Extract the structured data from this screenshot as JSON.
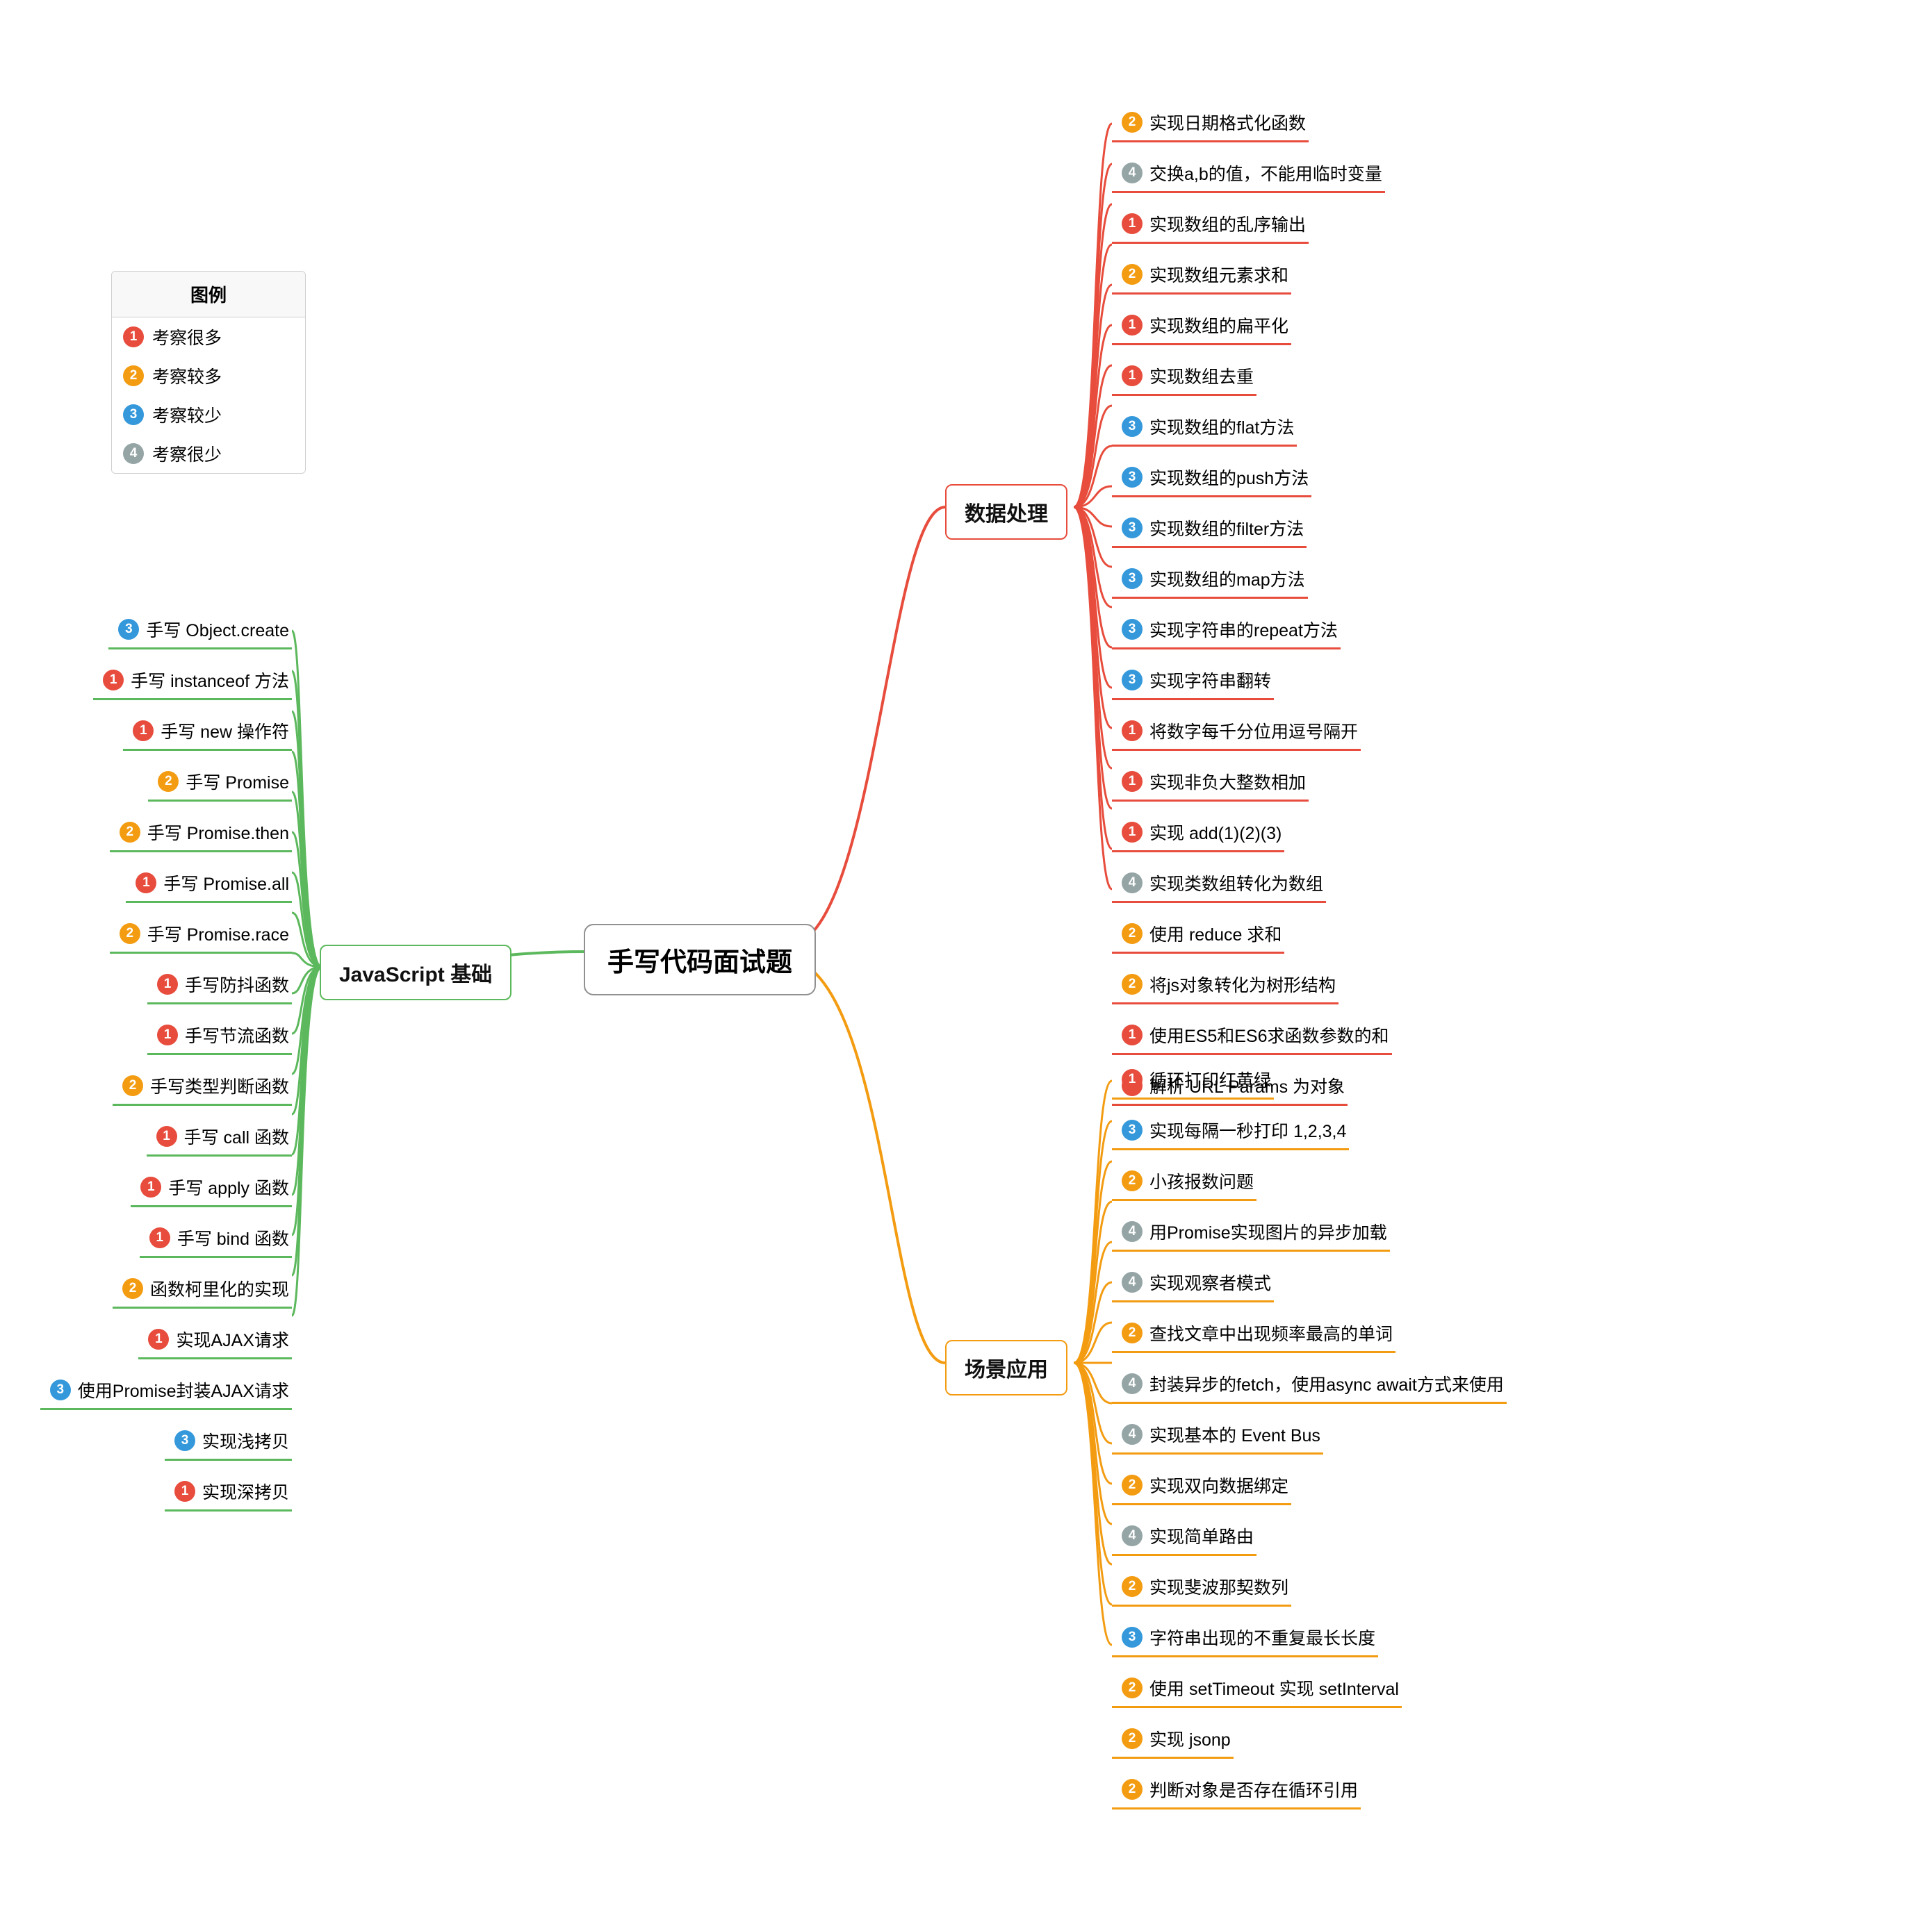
{
  "root": "手写代码面试题",
  "legend": {
    "title": "图例",
    "items": [
      {
        "level": 1,
        "text": "考察很多"
      },
      {
        "level": 2,
        "text": "考察较多"
      },
      {
        "level": 3,
        "text": "考察较少"
      },
      {
        "level": 4,
        "text": "考察很少"
      }
    ]
  },
  "branches": {
    "js": {
      "label": "JavaScript 基础",
      "color": "green",
      "side": "left",
      "items": [
        {
          "level": 3,
          "text": "手写 Object.create"
        },
        {
          "level": 1,
          "text": "手写 instanceof 方法"
        },
        {
          "level": 1,
          "text": "手写 new 操作符"
        },
        {
          "level": 2,
          "text": "手写 Promise"
        },
        {
          "level": 2,
          "text": "手写 Promise.then"
        },
        {
          "level": 1,
          "text": "手写 Promise.all"
        },
        {
          "level": 2,
          "text": "手写 Promise.race"
        },
        {
          "level": 1,
          "text": "手写防抖函数"
        },
        {
          "level": 1,
          "text": "手写节流函数"
        },
        {
          "level": 2,
          "text": "手写类型判断函数"
        },
        {
          "level": 1,
          "text": "手写 call 函数"
        },
        {
          "level": 1,
          "text": "手写 apply 函数"
        },
        {
          "level": 1,
          "text": "手写 bind 函数"
        },
        {
          "level": 2,
          "text": "函数柯里化的实现"
        },
        {
          "level": 1,
          "text": "实现AJAX请求"
        },
        {
          "level": 3,
          "text": "使用Promise封装AJAX请求"
        },
        {
          "level": 3,
          "text": "实现浅拷贝"
        },
        {
          "level": 1,
          "text": "实现深拷贝"
        }
      ]
    },
    "data": {
      "label": "数据处理",
      "color": "red",
      "side": "right",
      "items": [
        {
          "level": 2,
          "text": "实现日期格式化函数"
        },
        {
          "level": 4,
          "text": "交换a,b的值，不能用临时变量"
        },
        {
          "level": 1,
          "text": "实现数组的乱序输出"
        },
        {
          "level": 2,
          "text": "实现数组元素求和"
        },
        {
          "level": 1,
          "text": "实现数组的扁平化"
        },
        {
          "level": 1,
          "text": "实现数组去重"
        },
        {
          "level": 3,
          "text": "实现数组的flat方法"
        },
        {
          "level": 3,
          "text": "实现数组的push方法"
        },
        {
          "level": 3,
          "text": "实现数组的filter方法"
        },
        {
          "level": 3,
          "text": "实现数组的map方法"
        },
        {
          "level": 3,
          "text": "实现字符串的repeat方法"
        },
        {
          "level": 3,
          "text": "实现字符串翻转"
        },
        {
          "level": 1,
          "text": "将数字每千分位用逗号隔开"
        },
        {
          "level": 1,
          "text": "实现非负大整数相加"
        },
        {
          "level": 1,
          "text": "实现 add(1)(2)(3)"
        },
        {
          "level": 4,
          "text": "实现类数组转化为数组"
        },
        {
          "level": 2,
          "text": "使用 reduce 求和"
        },
        {
          "level": 2,
          "text": "将js对象转化为树形结构"
        },
        {
          "level": 1,
          "text": "使用ES5和ES6求函数参数的和"
        },
        {
          "level": 1,
          "text": "解析 URL Params 为对象"
        }
      ]
    },
    "scene": {
      "label": "场景应用",
      "color": "orange",
      "side": "right",
      "items": [
        {
          "level": 1,
          "text": "循环打印红黄绿"
        },
        {
          "level": 3,
          "text": "实现每隔一秒打印 1,2,3,4"
        },
        {
          "level": 2,
          "text": "小孩报数问题"
        },
        {
          "level": 4,
          "text": "用Promise实现图片的异步加载"
        },
        {
          "level": 4,
          "text": "实现观察者模式"
        },
        {
          "level": 2,
          "text": "查找文章中出现频率最高的单词"
        },
        {
          "level": 4,
          "text": "封装异步的fetch，使用async await方式来使用"
        },
        {
          "level": 4,
          "text": "实现基本的 Event Bus"
        },
        {
          "level": 2,
          "text": "实现双向数据绑定"
        },
        {
          "level": 4,
          "text": "实现简单路由"
        },
        {
          "level": 2,
          "text": "实现斐波那契数列"
        },
        {
          "level": 3,
          "text": "字符串出现的不重复最长长度"
        },
        {
          "level": 2,
          "text": "使用 setTimeout 实现 setInterval"
        },
        {
          "level": 2,
          "text": "实现 jsonp"
        },
        {
          "level": 2,
          "text": "判断对象是否存在循环引用"
        }
      ]
    }
  }
}
